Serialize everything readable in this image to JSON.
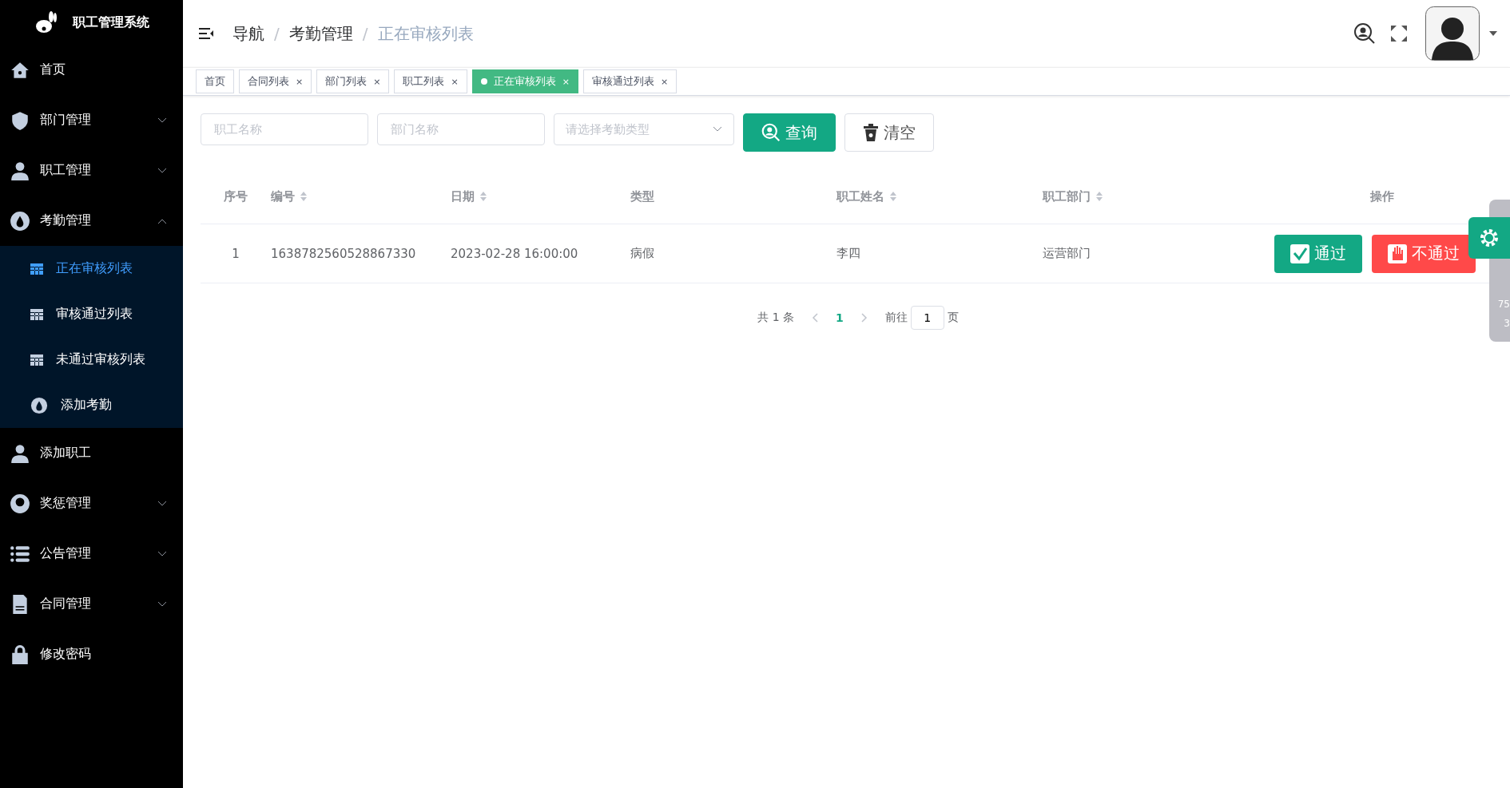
{
  "app_title": "职工管理系统",
  "menu": [
    {
      "label": "首页",
      "kind": "item"
    },
    {
      "label": "部门管理",
      "kind": "group",
      "expanded": false
    },
    {
      "label": "职工管理",
      "kind": "group",
      "expanded": false
    },
    {
      "label": "考勤管理",
      "kind": "group",
      "expanded": true,
      "children": [
        {
          "label": "正在审核列表",
          "selected": true
        },
        {
          "label": "审核通过列表",
          "selected": false
        },
        {
          "label": "未通过审核列表",
          "selected": false
        },
        {
          "label": "添加考勤",
          "selected": false
        }
      ]
    },
    {
      "label": "添加职工",
      "kind": "item"
    },
    {
      "label": "奖惩管理",
      "kind": "group",
      "expanded": false
    },
    {
      "label": "公告管理",
      "kind": "group",
      "expanded": false
    },
    {
      "label": "合同管理",
      "kind": "group",
      "expanded": false
    },
    {
      "label": "修改密码",
      "kind": "item"
    }
  ],
  "breadcrumb": [
    {
      "kind": "link",
      "text": "导航"
    },
    {
      "kind": "separator",
      "text": "/"
    },
    {
      "kind": "link",
      "text": "考勤管理"
    },
    {
      "kind": "separator",
      "text": "/"
    },
    {
      "kind": "current",
      "text": "正在审核列表"
    }
  ],
  "tabs": [
    {
      "label": "首页",
      "selected": false
    },
    {
      "label": "合同列表",
      "selected": false,
      "close": "×"
    },
    {
      "label": "部门列表",
      "selected": false,
      "close": "×"
    },
    {
      "label": "职工列表",
      "selected": false,
      "close": "×"
    },
    {
      "label": "正在审核列表",
      "selected": true,
      "close": "×"
    },
    {
      "label": "审核通过列表",
      "selected": false,
      "close": "×"
    }
  ],
  "filters": {
    "employee": {
      "placeholder": "职工名称"
    },
    "department": {
      "placeholder": "部门名称"
    },
    "type": {
      "placeholder": "请选择考勤类型"
    },
    "search_button": "查询",
    "clear_button": "清空"
  },
  "table": {
    "columns": [
      {
        "label": "序号",
        "sortable": false
      },
      {
        "label": "编号",
        "sortable": true
      },
      {
        "label": "日期",
        "sortable": true
      },
      {
        "label": "类型",
        "sortable": false
      },
      {
        "label": "职工姓名",
        "sortable": true
      },
      {
        "label": "职工部门",
        "sortable": true
      },
      {
        "label": "操作",
        "sortable": false
      }
    ],
    "rows": [
      {
        "cells": [
          "1",
          "1638782560528867330",
          "2023-02-28 16:00:00",
          "病假",
          "李四",
          "运营部门"
        ],
        "approve": "通过",
        "reject": "不通过"
      }
    ]
  },
  "pagination": {
    "total": "共 1 条",
    "pages": [
      {
        "label": "1",
        "selected": true
      }
    ],
    "goto_label": "前往",
    "goto_value": "1",
    "page_suffix": "页"
  },
  "side_widget": {
    "readings": [
      "75",
      "3"
    ]
  }
}
